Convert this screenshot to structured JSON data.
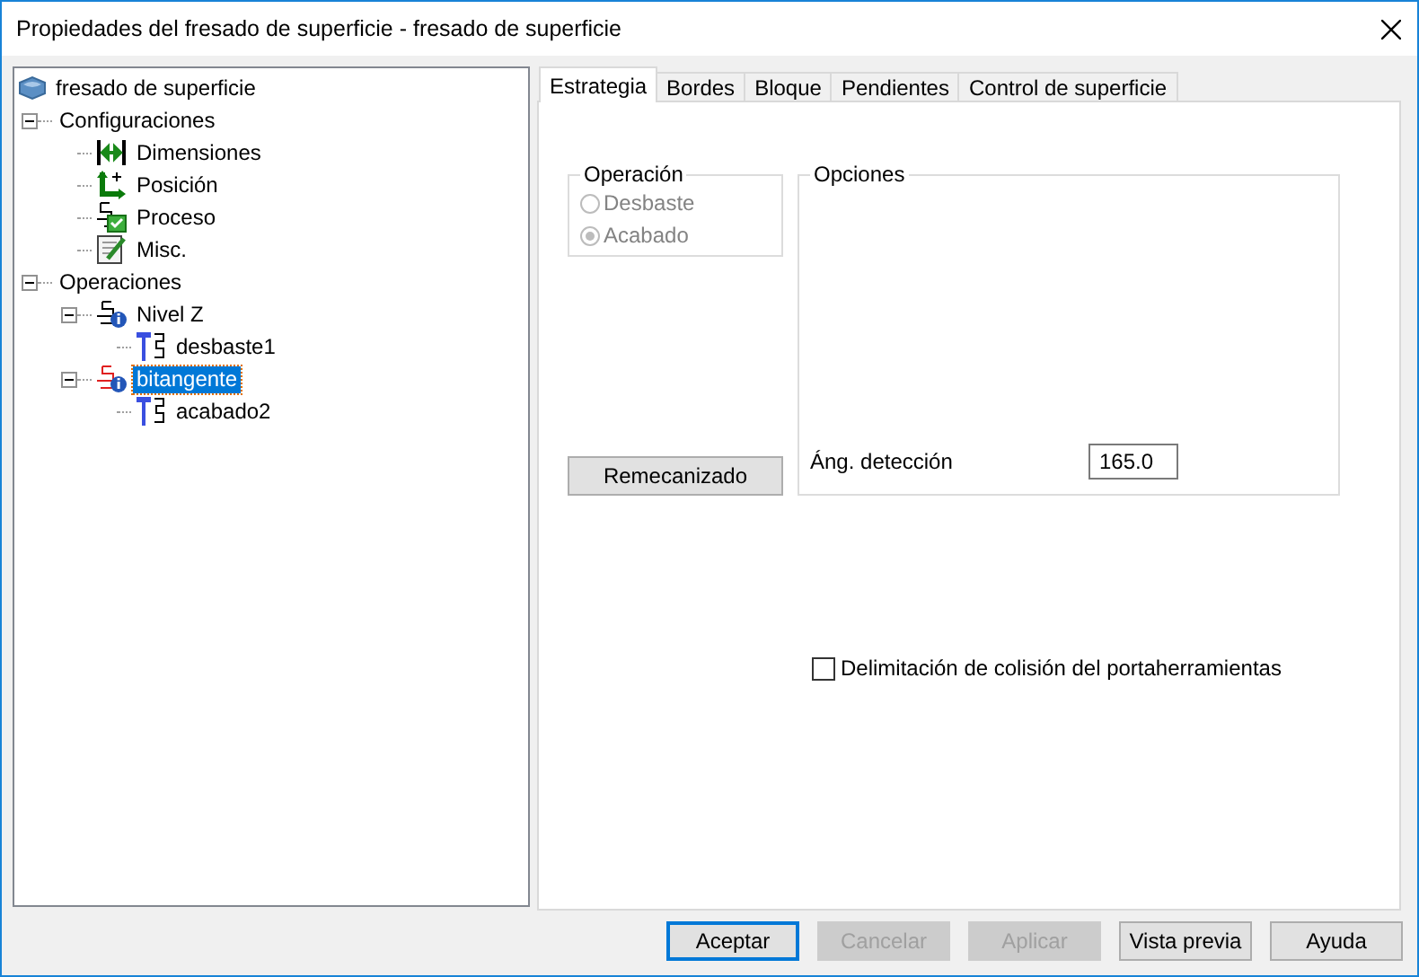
{
  "window": {
    "title": "Propiedades del fresado de superficie - fresado de superficie"
  },
  "tree": [
    {
      "label": "fresado de superficie",
      "kind": "model",
      "selected": false,
      "children": [
        {
          "label": "Configuraciones",
          "selected": false,
          "expanded": true,
          "children": [
            {
              "label": "Dimensiones",
              "kind": "dimensions",
              "selected": false
            },
            {
              "label": "Posición",
              "kind": "position",
              "selected": false
            },
            {
              "label": "Proceso",
              "kind": "process",
              "selected": false
            },
            {
              "label": "Misc.",
              "kind": "misc",
              "selected": false
            }
          ]
        },
        {
          "label": "Operaciones",
          "selected": false,
          "expanded": true,
          "children": [
            {
              "label": "Nivel Z",
              "kind": "strategy",
              "selected": false,
              "expanded": true,
              "children": [
                {
                  "label": "desbaste1",
                  "kind": "tool",
                  "selected": false
                }
              ]
            },
            {
              "label": "bitangente",
              "kind": "strategy-red",
              "selected": true,
              "expanded": true,
              "children": [
                {
                  "label": "acabado2",
                  "kind": "tool",
                  "selected": false
                }
              ]
            }
          ]
        }
      ]
    }
  ],
  "tabs": [
    {
      "label": "Estrategia",
      "selected": true
    },
    {
      "label": "Bordes",
      "selected": false
    },
    {
      "label": "Bloque",
      "selected": false
    },
    {
      "label": "Pendientes",
      "selected": false
    },
    {
      "label": "Control de superficie",
      "selected": false
    }
  ],
  "operation_group": {
    "title": "Operación",
    "disabled": true,
    "options": [
      {
        "label": "Desbaste",
        "selected": false
      },
      {
        "label": "Acabado",
        "selected": true
      }
    ]
  },
  "remachining_button": {
    "label": "Remecanizado"
  },
  "options_group": {
    "title": "Opciones",
    "angle_label": "Áng. detección",
    "angle_value": "165.0"
  },
  "holder_collision": {
    "label": "Delimitación de colisión del portaherramientas",
    "checked": false
  },
  "buttons": [
    {
      "label": "Aceptar",
      "disabled": false,
      "default": true
    },
    {
      "label": "Cancelar",
      "disabled": true,
      "default": false
    },
    {
      "label": "Aplicar",
      "disabled": true,
      "default": false
    },
    {
      "label": "Vista previa",
      "disabled": false,
      "default": false
    },
    {
      "label": "Ayuda",
      "disabled": false,
      "default": false
    }
  ]
}
